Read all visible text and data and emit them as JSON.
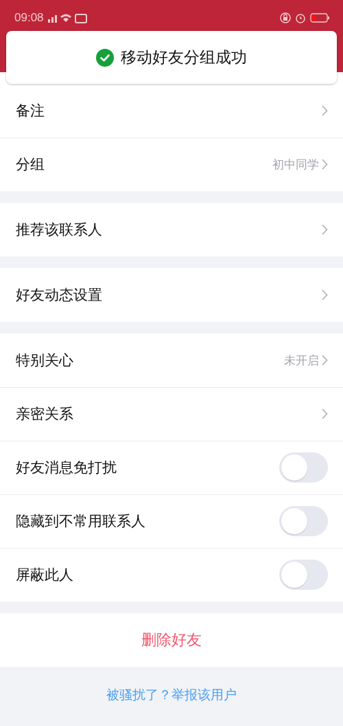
{
  "status_bar": {
    "time": "09:08"
  },
  "toast": {
    "text": "移动好友分组成功"
  },
  "sections": [
    {
      "rows": [
        {
          "kind": "link",
          "label": "备注"
        },
        {
          "kind": "link",
          "label": "分组",
          "value": "初中同学"
        }
      ]
    },
    {
      "rows": [
        {
          "kind": "link",
          "label": "推荐该联系人"
        }
      ]
    },
    {
      "rows": [
        {
          "kind": "link",
          "label": "好友动态设置"
        }
      ]
    },
    {
      "rows": [
        {
          "kind": "link",
          "label": "特别关心",
          "value": "未开启"
        },
        {
          "kind": "link",
          "label": "亲密关系"
        },
        {
          "kind": "toggle",
          "label": "好友消息免打扰",
          "on": false
        },
        {
          "kind": "toggle",
          "label": "隐藏到不常用联系人",
          "on": false
        },
        {
          "kind": "toggle",
          "label": "屏蔽此人",
          "on": false
        }
      ]
    }
  ],
  "delete_button": "删除好友",
  "report_link": "被骚扰了？举报该用户"
}
